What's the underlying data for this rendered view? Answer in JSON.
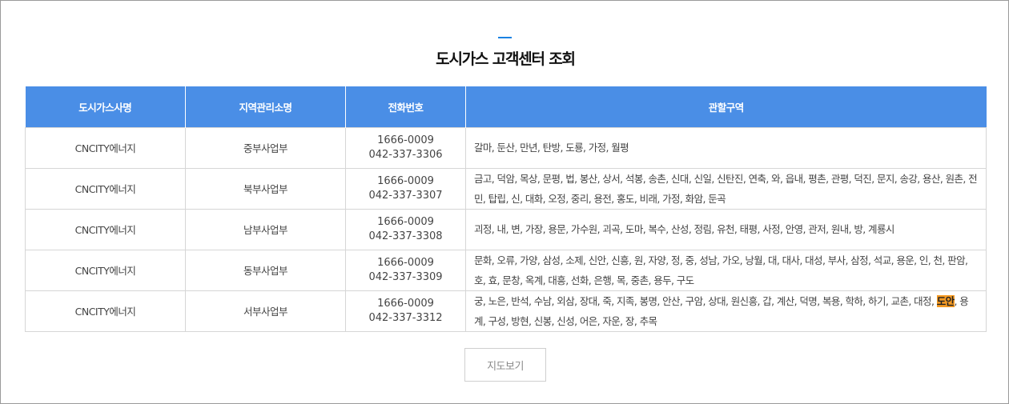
{
  "page": {
    "title": "도시가스 고객센터 조회",
    "accent_color": "#1a82e2",
    "header_color": "#4a8ee6"
  },
  "table": {
    "headers": [
      "도시가스사명",
      "지역관리소명",
      "전화번호",
      "관할구역"
    ],
    "rows": [
      {
        "company": "CNCITY에너지",
        "office": "중부사업부",
        "phone1": "1666-0009",
        "phone2": "042-337-3306",
        "areas": "갈마, 둔산, 만년, 탄방, 도룡, 가정, 월평"
      },
      {
        "company": "CNCITY에너지",
        "office": "북부사업부",
        "phone1": "1666-0009",
        "phone2": "042-337-3307",
        "areas": "금고, 덕암, 목상, 문평, 법, 봉산, 상서, 석봉, 송촌, 신대, 신일, 신탄진, 연축, 와, 읍내, 평촌, 관평, 덕진, 문지, 송강, 용산, 원촌, 전민, 탑립, 신, 대화, 오정, 중리, 용전, 홍도, 비래, 가정, 화암, 둔곡"
      },
      {
        "company": "CNCITY에너지",
        "office": "남부사업부",
        "phone1": "1666-0009",
        "phone2": "042-337-3308",
        "areas": "괴정, 내, 변, 가장, 용문, 가수원, 괴곡, 도마, 복수, 산성, 정림, 유천, 태평, 사정, 안영, 관저, 원내, 방, 계룡시"
      },
      {
        "company": "CNCITY에너지",
        "office": "동부사업부",
        "phone1": "1666-0009",
        "phone2": "042-337-3309",
        "areas": "문화, 오류, 가양, 삼성, 소제, 신안, 신흥, 원, 자양, 정, 중, 성남, 가오, 낭월, 대, 대사, 대성, 부사, 삼정, 석교, 용운, 인, 천, 판암, 호, 효, 문창, 옥계, 대흥, 선화, 은행, 목, 중촌, 용두, 구도"
      },
      {
        "company": "CNCITY에너지",
        "office": "서부사업부",
        "phone1": "1666-0009",
        "phone2": "042-337-3312",
        "areas_before": "궁, 노은, 반석, 수남, 외삼, 장대, 죽, 지족, 봉명, 안산, 구암, 상대, 원신흥, 갑, 계산, 덕명, 복용, 학하, 하기, 교촌, 대정, ",
        "areas_highlight": "도안",
        "areas_after": ", 용계, 구성, 방현, 신봉, 신성, 어은, 자운, 장, 추목"
      }
    ]
  },
  "buttons": {
    "map_label": "지도보기"
  }
}
